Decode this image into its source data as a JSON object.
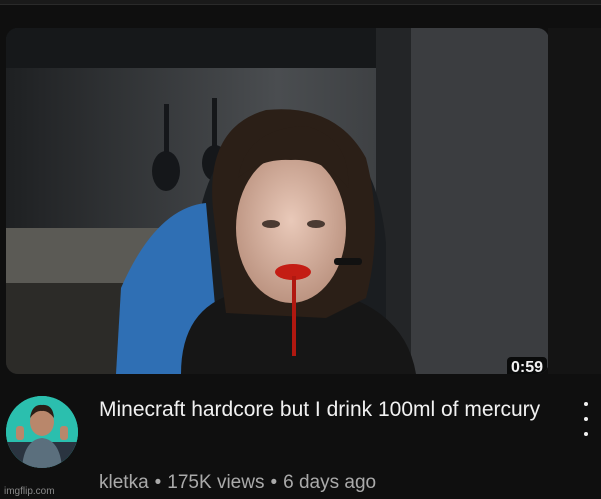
{
  "video": {
    "duration": "0:59",
    "title": "Minecraft hardcore but I drink 100ml of mercury",
    "channel": "kletka",
    "views": "175K views",
    "age": "6 days ago",
    "separator": "•"
  },
  "icons": {
    "more": "three-dot-vertical-icon"
  },
  "watermark": "imgflip.com",
  "colors": {
    "background": "#0f0f0f",
    "title": "#f1f1f1",
    "meta": "#aaaaaa"
  }
}
